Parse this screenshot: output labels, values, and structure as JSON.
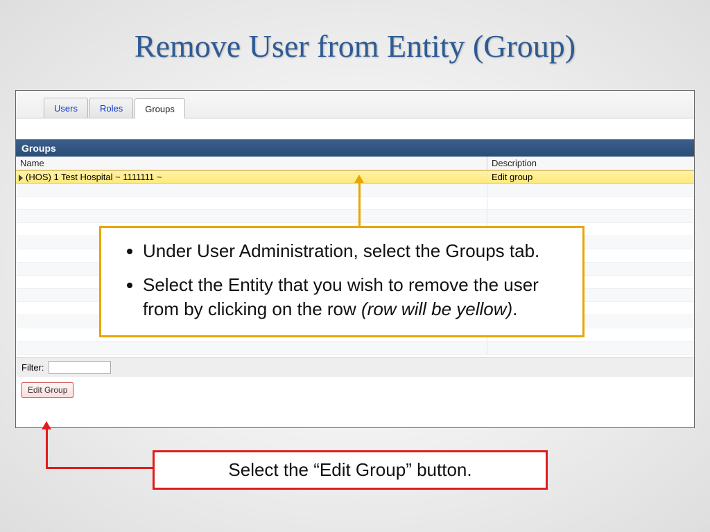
{
  "slide": {
    "title": "Remove User from Entity (Group)"
  },
  "tabs": {
    "users": "Users",
    "roles": "Roles",
    "groups": "Groups"
  },
  "panel": {
    "header": "Groups",
    "col_name": "Name",
    "col_desc": "Description"
  },
  "rows": {
    "selected_name": "(HOS) 1 Test Hospital ~ 1111111 ~",
    "selected_desc": "Edit group"
  },
  "filter": {
    "label": "Filter:",
    "value": ""
  },
  "buttons": {
    "edit_group": "Edit Group"
  },
  "callout_yellow": {
    "item1": "Under User Administration, select the Groups tab.",
    "item2a": "Select the Entity that you wish to remove the user from by clicking on the row ",
    "item2b": "(row will be yellow)",
    "item2c": "."
  },
  "callout_red": {
    "text": "Select the “Edit Group” button."
  }
}
